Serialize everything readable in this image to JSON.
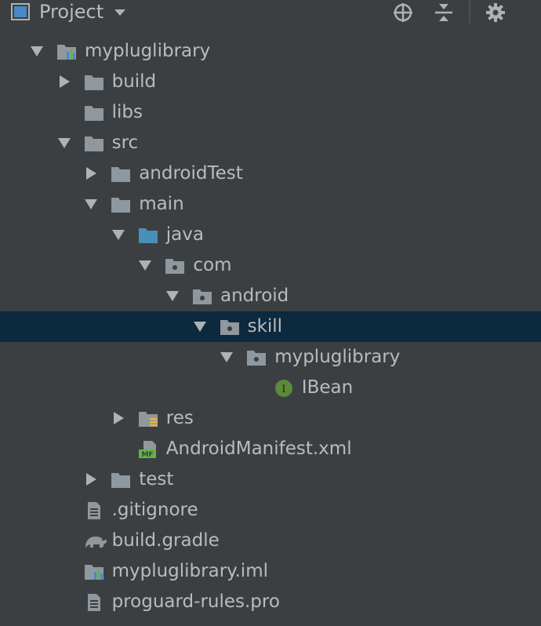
{
  "panel": {
    "title": "Project",
    "header_icons": [
      "project-view-icon",
      "dropdown-caret-icon",
      "locate-icon",
      "collapse-all-icon",
      "gear-icon"
    ]
  },
  "tree": {
    "rows": [
      {
        "label": "mypluglibrary",
        "icon": "module-icon",
        "expanded": true
      },
      {
        "label": "build",
        "icon": "folder-icon",
        "expanded": false
      },
      {
        "label": "libs",
        "icon": "folder-icon"
      },
      {
        "label": "src",
        "icon": "folder-icon",
        "expanded": true
      },
      {
        "label": "androidTest",
        "icon": "folder-icon",
        "expanded": false
      },
      {
        "label": "main",
        "icon": "folder-icon",
        "expanded": true
      },
      {
        "label": "java",
        "icon": "source-folder-icon",
        "expanded": true
      },
      {
        "label": "com",
        "icon": "package-icon",
        "expanded": true
      },
      {
        "label": "android",
        "icon": "package-icon",
        "expanded": true
      },
      {
        "label": "skill",
        "icon": "package-icon",
        "expanded": true,
        "selected": true
      },
      {
        "label": "mypluglibrary",
        "icon": "package-icon",
        "expanded": true
      },
      {
        "label": "IBean",
        "icon": "interface-icon"
      },
      {
        "label": "res",
        "icon": "resource-folder-icon",
        "expanded": false
      },
      {
        "label": "AndroidManifest.xml",
        "icon": "manifest-icon"
      },
      {
        "label": "test",
        "icon": "folder-icon",
        "expanded": false
      },
      {
        "label": ".gitignore",
        "icon": "text-file-icon"
      },
      {
        "label": "build.gradle",
        "icon": "gradle-icon"
      },
      {
        "label": "mypluglibrary.iml",
        "icon": "module-file-icon"
      },
      {
        "label": "proguard-rules.pro",
        "icon": "text-file-icon"
      }
    ]
  },
  "colors": {
    "background": "#3c3f41",
    "selection": "#0d293e",
    "text": "#bbbbbb",
    "folder": "#8f989e",
    "source_folder": "#4a8fb8",
    "interface_badge": "#5a8a3a"
  }
}
